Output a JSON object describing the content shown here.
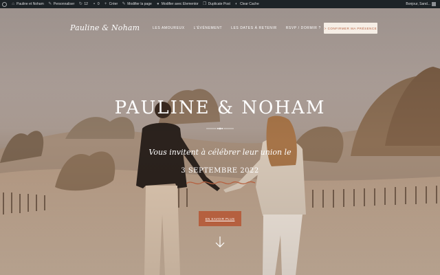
{
  "adminbar": {
    "site_name": "Pauline et Noham",
    "customize": "Personnaliser",
    "updates_count": "12",
    "comments_count": "0",
    "new_label": "Créer",
    "edit_page": "Modifier la page",
    "elementor": "Modifier avec Elementor",
    "duplicate": "Duplicate Post",
    "cache": "Clear Cache",
    "greeting": "Bonjour, Sand..."
  },
  "header": {
    "logo": "Pauline & Noham",
    "nav": [
      "LES AMOUREUX",
      "L'ÉVÉNEMENT",
      "LES DATES À RETENIR",
      "RSVP / DORMIR ?"
    ],
    "cta": "> CONFIRMER MA PRÉSENCE"
  },
  "hero": {
    "title": "PAULINE & NOHAM",
    "invite": "Vous invitent à célébrer leur union le",
    "date": "3 SEPTEMBRE 2022",
    "button": "EN SAVOIR PLUS"
  },
  "colors": {
    "accent": "#b5603f",
    "adminbar_bg": "#1d2327",
    "cta_bg": "#f6eee6"
  }
}
